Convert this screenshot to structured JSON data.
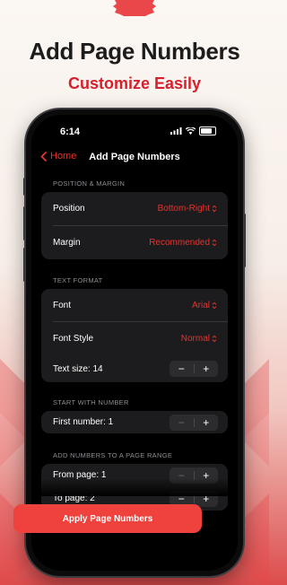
{
  "promo": {
    "headline": "Add Page Numbers",
    "subheadline": "Customize Easily"
  },
  "status_bar": {
    "time": "6:14"
  },
  "navbar": {
    "back_label": "Home",
    "title": "Add Page Numbers"
  },
  "sections": {
    "position_margin": {
      "header": "POSITION & MARGIN",
      "position": {
        "label": "Position",
        "value": "Bottom-Right"
      },
      "margin": {
        "label": "Margin",
        "value": "Recommended"
      }
    },
    "text_format": {
      "header": "TEXT FORMAT",
      "font": {
        "label": "Font",
        "value": "Arial"
      },
      "font_style": {
        "label": "Font Style",
        "value": "Normal"
      },
      "text_size": {
        "label": "Text size: 14"
      }
    },
    "start_number": {
      "header": "START WITH NUMBER",
      "first_number": {
        "label": "First number: 1"
      }
    },
    "page_range": {
      "header": "ADD NUMBERS TO A PAGE RANGE",
      "from_page": {
        "label": "From page: 1"
      },
      "to_page": {
        "label": "To page: 2"
      }
    }
  },
  "stepper": {
    "minus": "−",
    "plus": "+"
  },
  "apply_button": {
    "label": "Apply Page Numbers"
  },
  "colors": {
    "accent": "#e3342f",
    "button": "#f0423d",
    "headline_red": "#d6202d"
  },
  "icons": [
    "chevron-left-icon",
    "chevron-updown-icon",
    "signal-icon",
    "wifi-icon",
    "battery-icon"
  ]
}
